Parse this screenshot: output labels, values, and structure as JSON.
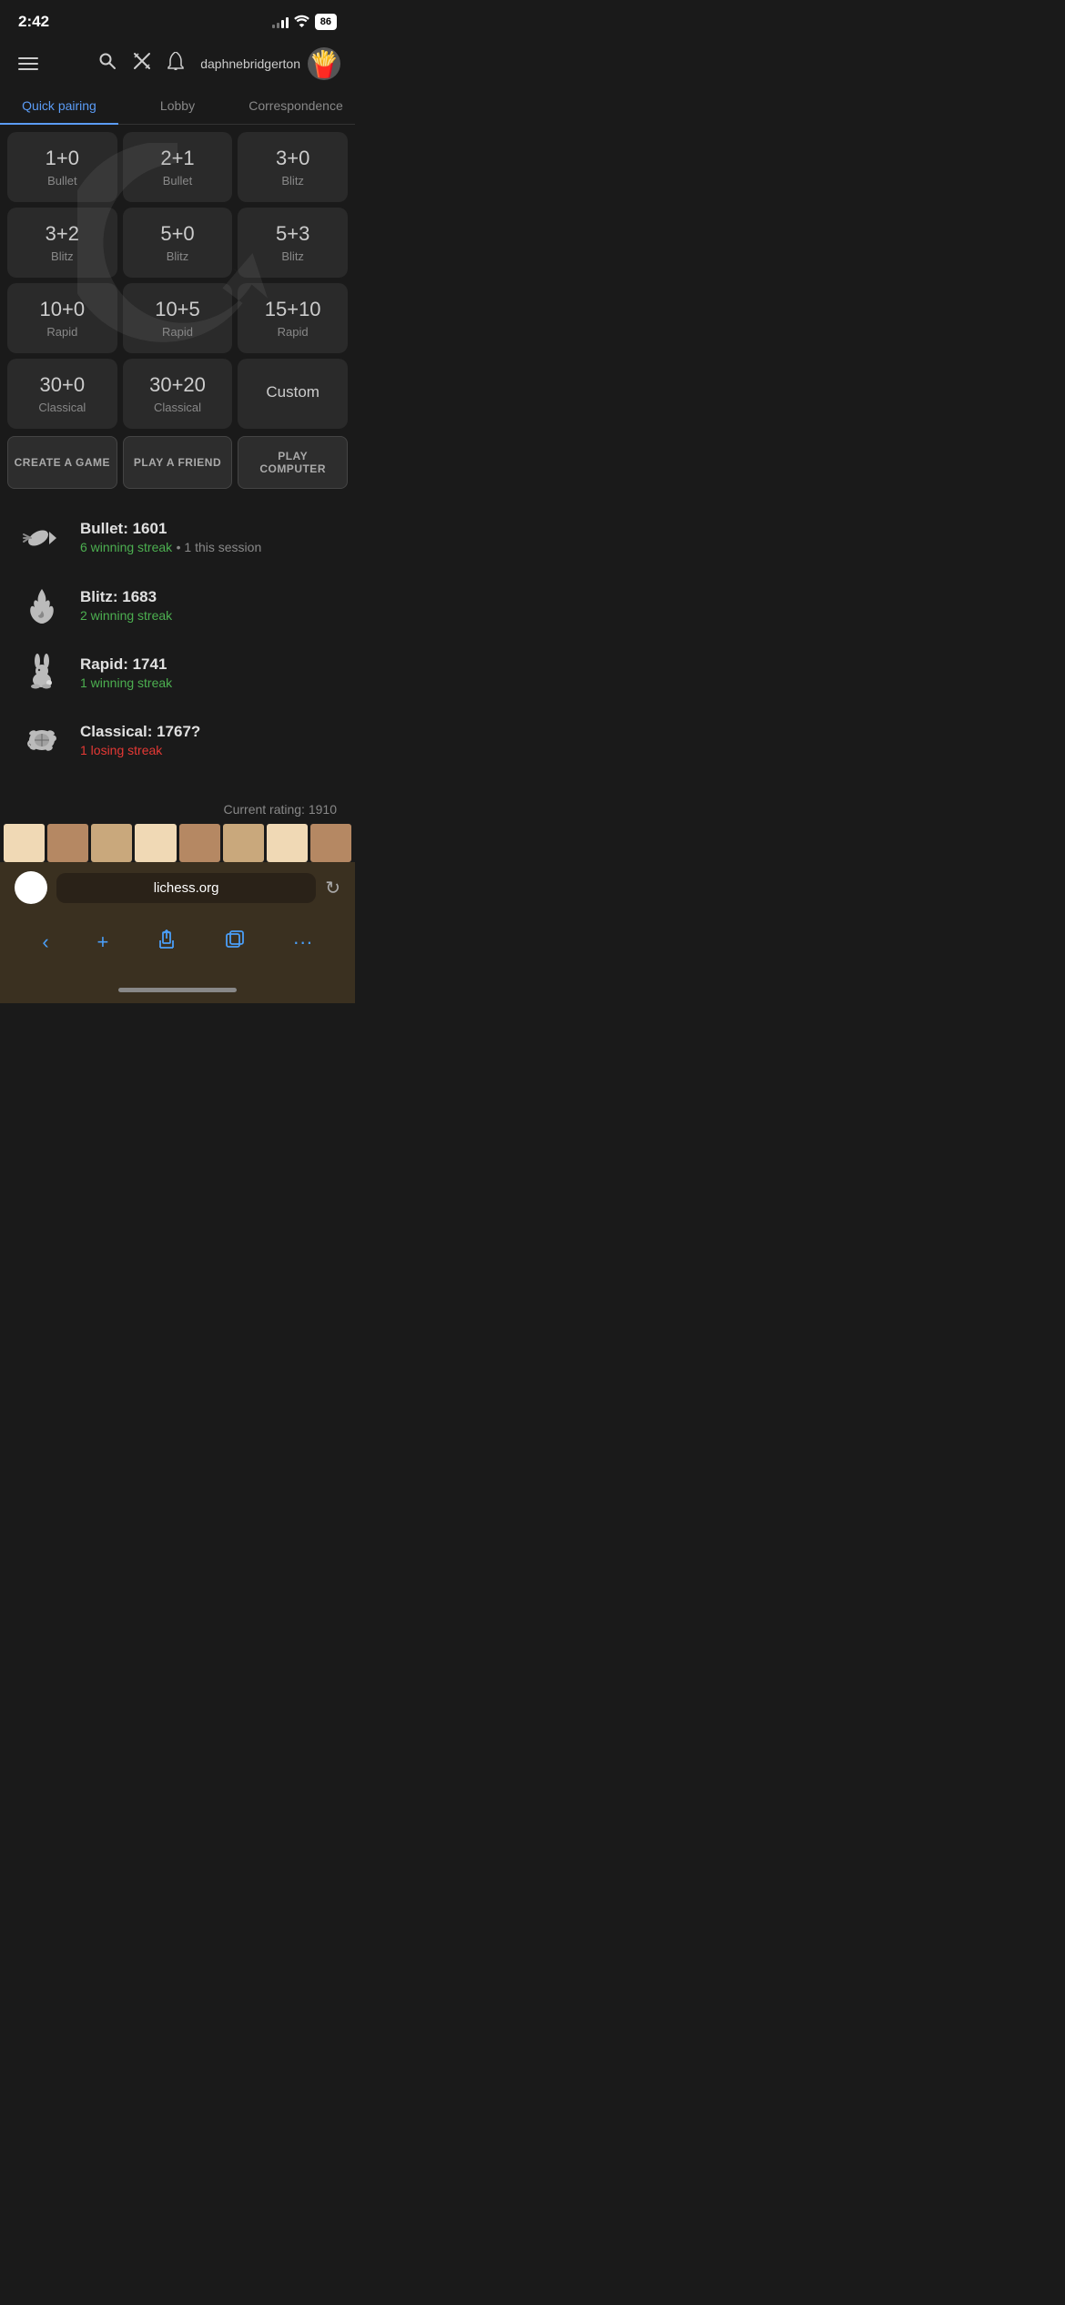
{
  "statusBar": {
    "time": "2:42",
    "battery": "86"
  },
  "nav": {
    "username": "daphnebridgerton",
    "avatar": "🍟"
  },
  "tabs": [
    {
      "label": "Quick pairing",
      "active": true
    },
    {
      "label": "Lobby",
      "active": false
    },
    {
      "label": "Correspondence",
      "active": false
    }
  ],
  "gameModes": [
    {
      "time": "1+0",
      "mode": "Bullet"
    },
    {
      "time": "2+1",
      "mode": "Bullet"
    },
    {
      "time": "3+0",
      "mode": "Blitz"
    },
    {
      "time": "3+2",
      "mode": "Blitz"
    },
    {
      "time": "5+0",
      "mode": "Blitz"
    },
    {
      "time": "5+3",
      "mode": "Blitz"
    },
    {
      "time": "10+0",
      "mode": "Rapid"
    },
    {
      "time": "10+5",
      "mode": "Rapid"
    },
    {
      "time": "15+10",
      "mode": "Rapid"
    },
    {
      "time": "30+0",
      "mode": "Classical"
    },
    {
      "time": "30+20",
      "mode": "Classical"
    },
    {
      "time": "Custom",
      "mode": ""
    }
  ],
  "actionButtons": [
    {
      "label": "CREATE A GAME"
    },
    {
      "label": "PLAY A FRIEND"
    },
    {
      "label": "PLAY COMPUTER"
    }
  ],
  "ratings": [
    {
      "type": "bullet",
      "title": "Bullet: 1601",
      "streak": "6 winning streak",
      "streakType": "green",
      "session": "• 1 this session"
    },
    {
      "type": "blitz",
      "title": "Blitz: 1683",
      "streak": "2 winning streak",
      "streakType": "green",
      "session": ""
    },
    {
      "type": "rapid",
      "title": "Rapid: 1741",
      "streak": "1 winning streak",
      "streakType": "green",
      "session": ""
    },
    {
      "type": "classical",
      "title": "Classical: 1767?",
      "streak": "1 losing streak",
      "streakType": "red",
      "session": ""
    }
  ],
  "currentRating": "Current rating: 1910",
  "browserUrl": "lichess.org"
}
